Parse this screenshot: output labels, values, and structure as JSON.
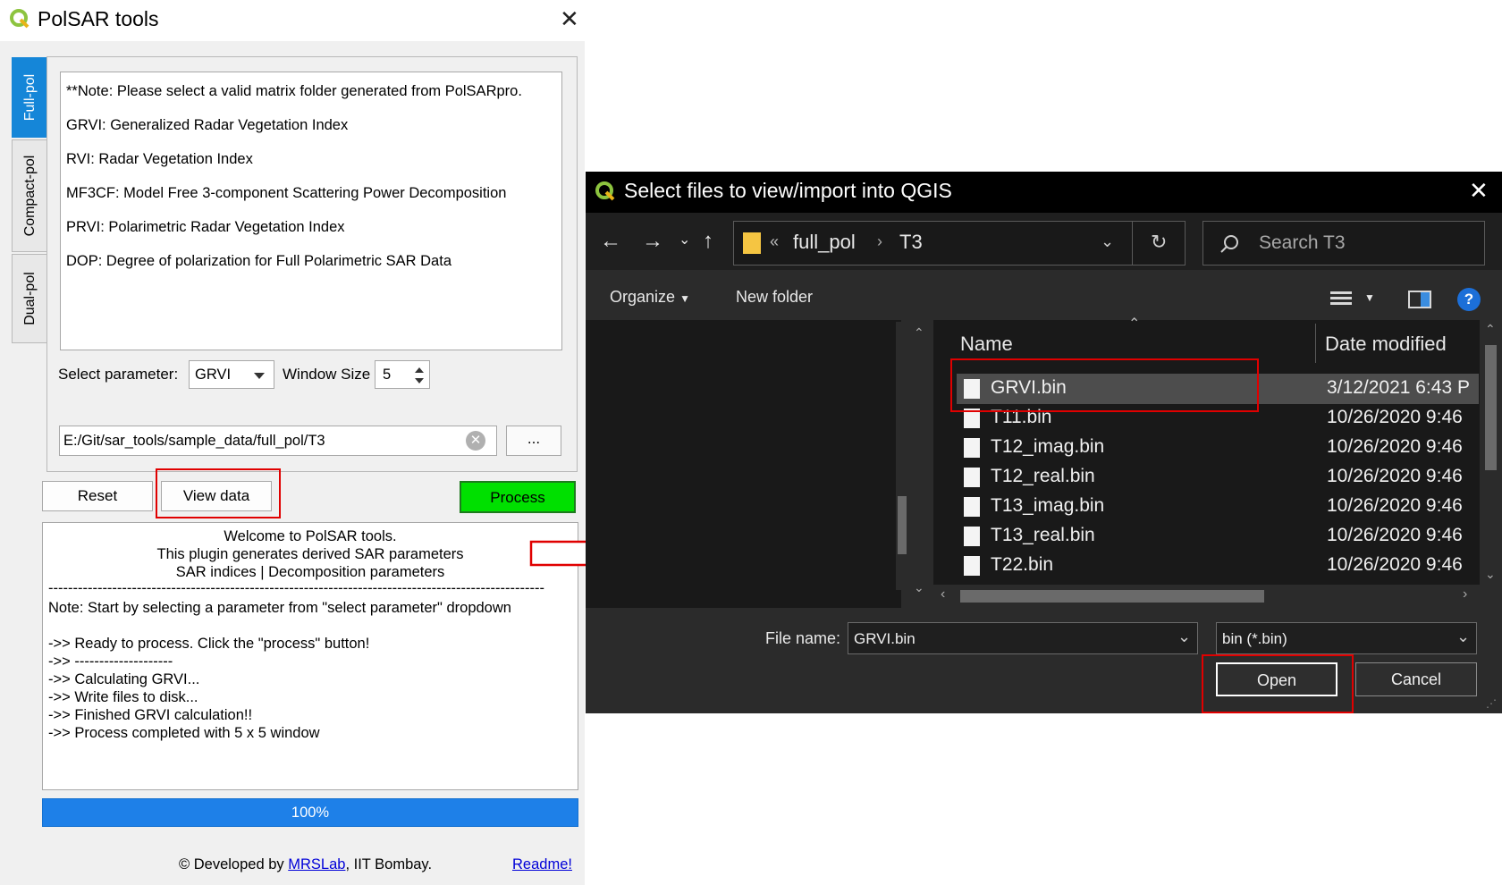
{
  "left_window": {
    "title": "PolSAR tools",
    "close_glyph": "✕",
    "tabs": [
      "Full-pol",
      "Compact-pol",
      "Dual-pol"
    ],
    "notes": [
      "**Note: Please select a valid matrix folder generated from PolSARpro.",
      "GRVI: Generalized Radar Vegetation Index",
      "RVI: Radar Vegetation Index",
      "MF3CF: Model Free 3-component Scattering Power Decomposition",
      "PRVI: Polarimetric Radar Vegetation Index",
      "DOP: Degree of polarization for Full Polarimetric SAR Data"
    ],
    "select_parameter_label": "Select parameter:",
    "selected_parameter": "GRVI",
    "window_size_label": "Window Size",
    "window_size": "5",
    "path": "E:/Git/sar_tools/sample_data/full_pol/T3",
    "browse_label": "...",
    "reset_label": "Reset",
    "view_data_label": "View data",
    "process_label": "Process",
    "log_header": [
      "Welcome to PolSAR tools.",
      "This plugin generates derived SAR parameters",
      "SAR indices | Decomposition parameters"
    ],
    "log_separator": "-----------------------------------------------------------------------------------------------------",
    "log_lines": [
      "Note: Start by selecting a parameter from \"select parameter\" dropdown",
      "",
      "->> Ready to process. Click the \"process\" button!",
      "->> --------------------",
      "->> Calculating GRVI...",
      "->> Write files to disk...",
      "->> Finished GRVI calculation!!",
      "->> Process completed with 5 x 5 window"
    ],
    "progress_text": "100%",
    "progress_value": 1.0,
    "footer_prefix": "© Developed by ",
    "footer_link": "MRSLab",
    "footer_suffix": ", IIT Bombay.",
    "readme_link": "Readme!"
  },
  "dialog": {
    "title": "Select files to view/import into QGIS",
    "close_glyph": "✕",
    "breadcrumb_prefix": "«",
    "breadcrumb": [
      "full_pol",
      "T3"
    ],
    "search_placeholder": "Search T3",
    "organize_label": "Organize",
    "new_folder_label": "New folder",
    "columns": [
      "Name",
      "Date modified"
    ],
    "files": [
      {
        "name": "GRVI.bin",
        "date": "3/12/2021 6:43 P"
      },
      {
        "name": "T11.bin",
        "date": "10/26/2020 9:46"
      },
      {
        "name": "T12_imag.bin",
        "date": "10/26/2020 9:46"
      },
      {
        "name": "T12_real.bin",
        "date": "10/26/2020 9:46"
      },
      {
        "name": "T13_imag.bin",
        "date": "10/26/2020 9:46"
      },
      {
        "name": "T13_real.bin",
        "date": "10/26/2020 9:46"
      },
      {
        "name": "T22.bin",
        "date": "10/26/2020 9:46"
      }
    ],
    "file_name_label": "File name:",
    "file_name_value": "GRVI.bin",
    "file_type_value": "bin (*.bin)",
    "open_label": "Open",
    "cancel_label": "Cancel"
  },
  "colors": {
    "tab_active": "#1586d8",
    "process_button": "#00e000",
    "progress": "#1e80e8",
    "highlight": "#e00000",
    "dialog_bg": "#2b2b2b"
  }
}
